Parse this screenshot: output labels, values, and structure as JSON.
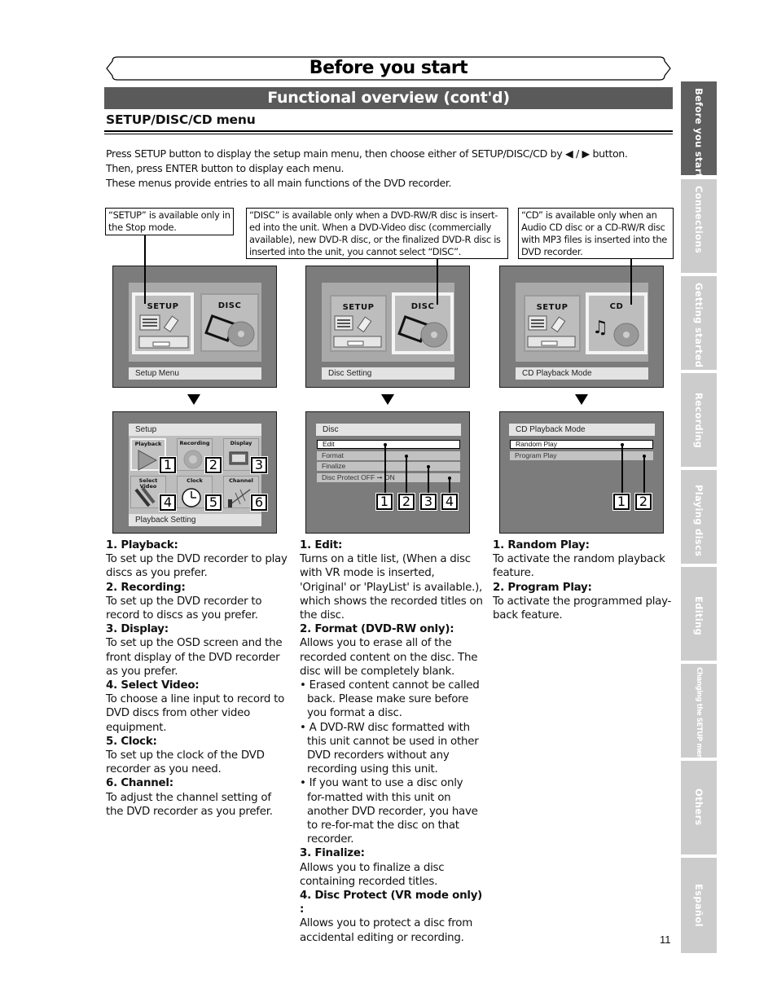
{
  "header": {
    "title": "Before you start",
    "section": "Functional overview (cont'd)",
    "subheading": "SETUP/DISC/CD menu"
  },
  "intro": {
    "line1": "Press SETUP button to display the setup main menu, then choose either of SETUP/DISC/CD by ◀ / ▶ button.",
    "line2": "Then, press ENTER button to display each menu.",
    "line3": "These menus provide entries to all main functions of the DVD recorder."
  },
  "notes": {
    "setup": "“SETUP” is available only in the Stop mode.",
    "disc": "“DISC” is available only when a DVD-RW/R disc is insert-ed into the unit.  When a DVD-Video disc (commercially available), new DVD-R disc, or the finalized DVD-R disc is inserted into the unit, you cannot select “DISC”.",
    "cd": "“CD” is available only when an Audio CD disc or a CD-RW/R disc with MP3 files is inserted into the DVD recorder."
  },
  "main_screens": [
    {
      "left_tile": "SETUP",
      "right_tile": "DISC",
      "selected": "SETUP",
      "caption": "Setup Menu"
    },
    {
      "left_tile": "SETUP",
      "right_tile": "DISC",
      "selected": "DISC",
      "caption": "Disc Setting"
    },
    {
      "left_tile": "SETUP",
      "right_tile": "CD",
      "selected": "CD",
      "caption": "CD Playback Mode"
    }
  ],
  "setup_screen": {
    "title": "Setup",
    "caption": "Playback Setting",
    "icons": [
      {
        "label": "Playback",
        "num": "1",
        "icon": "play-triangle-icon"
      },
      {
        "label": "Recording",
        "num": "2",
        "icon": "record-circle-icon"
      },
      {
        "label": "Display",
        "num": "3",
        "icon": "display-panel-icon"
      },
      {
        "label": "Select Video",
        "num": "4",
        "icon": "av-cable-icon"
      },
      {
        "label": "Clock",
        "num": "5",
        "icon": "clock-icon"
      },
      {
        "label": "Channel",
        "num": "6",
        "icon": "antenna-icon"
      }
    ]
  },
  "disc_screen": {
    "title": "Disc",
    "items": [
      "Edit",
      "Format",
      "Finalize",
      "Disc Protect OFF ➞ ON"
    ],
    "nums": [
      "1",
      "2",
      "3",
      "4"
    ]
  },
  "cd_screen": {
    "title": "CD Playback Mode",
    "items": [
      "Random Play",
      "Program Play"
    ],
    "nums": [
      "1",
      "2"
    ]
  },
  "descriptions": {
    "setup": [
      {
        "heading": "1. Playback:",
        "text": "To set up the DVD recorder to play discs as you prefer."
      },
      {
        "heading": "2. Recording:",
        "text": "To set up the DVD recorder to record to discs as you prefer."
      },
      {
        "heading": "3. Display:",
        "text": "To set up the OSD screen and the front display of the DVD recorder as you prefer."
      },
      {
        "heading": "4. Select Video:",
        "text": "To choose a line input to record to DVD discs from other video equipment."
      },
      {
        "heading": "5. Clock:",
        "text": "To set up the clock of the DVD recorder as you need."
      },
      {
        "heading": "6. Channel:",
        "text": "To adjust the channel setting of the DVD recorder as you prefer."
      }
    ],
    "disc": {
      "edit_heading": "1. Edit:",
      "edit_text": "Turns on a title list, (When a disc with VR mode is inserted, 'Original' or 'PlayList' is available.), which shows the recorded titles on the disc.",
      "format_heading": "2. Format (DVD-RW only):",
      "format_text": "Allows you to erase all of the recorded content on the disc. The disc will be completely blank.",
      "format_bullets": [
        "• Erased content cannot be called back. Please make sure before you format a disc.",
        "• A DVD-RW disc formatted with this unit cannot be used in other DVD recorders without any recording using this unit.",
        "• If you want to use a disc only for-matted with this unit on another DVD recorder, you have to re-for-mat the disc on that recorder."
      ],
      "finalize_heading": "3. Finalize:",
      "finalize_text": "Allows you to finalize a disc containing recorded titles.",
      "protect_heading": "4. Disc Protect (VR mode only) :",
      "protect_text": "Allows you to protect a disc from accidental editing or recording."
    },
    "cd": [
      {
        "heading": "1. Random Play:",
        "text": "To activate the random playback feature."
      },
      {
        "heading": "2. Program Play:",
        "text": "To activate the programmed play-back feature."
      }
    ]
  },
  "page_number": "11",
  "side_tabs": [
    {
      "label": "Before you start",
      "active": true
    },
    {
      "label": "Connections",
      "active": false
    },
    {
      "label": "Getting started",
      "active": false
    },
    {
      "label": "Recording",
      "active": false
    },
    {
      "label": "Playing discs",
      "active": false
    },
    {
      "label": "Editing",
      "active": false
    },
    {
      "label": "Changing the SETUP menu",
      "active": false
    },
    {
      "label": "Others",
      "active": false
    },
    {
      "label": "Español",
      "active": false
    }
  ]
}
